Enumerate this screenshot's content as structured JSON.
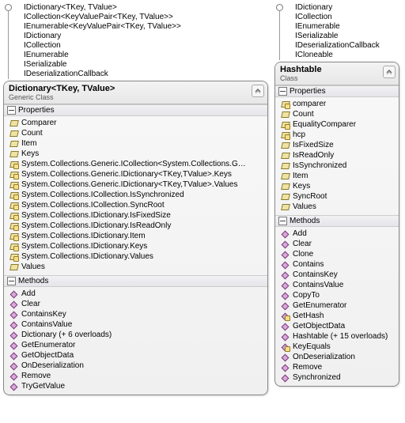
{
  "left": {
    "inherits": [
      "IDictionary<TKey, TValue>",
      "ICollection<KeyValuePair<TKey, TValue>>",
      "IEnumerable<KeyValuePair<TKey, TValue>>",
      "IDictionary",
      "ICollection",
      "IEnumerable",
      "ISerializable",
      "IDeserializationCallback"
    ],
    "title": "Dictionary<TKey, TValue>",
    "subtitle": "Generic Class",
    "sections": {
      "properties": {
        "label": "Properties",
        "items": [
          {
            "t": "Comparer",
            "p": false
          },
          {
            "t": "Count",
            "p": false
          },
          {
            "t": "Item",
            "p": false
          },
          {
            "t": "Keys",
            "p": false
          },
          {
            "t": "System.Collections.Generic.ICollection<System.Collections.G…",
            "p": true
          },
          {
            "t": "System.Collections.Generic.IDictionary<TKey,TValue>.Keys",
            "p": true
          },
          {
            "t": "System.Collections.Generic.IDictionary<TKey,TValue>.Values",
            "p": true
          },
          {
            "t": "System.Collections.ICollection.IsSynchronized",
            "p": true
          },
          {
            "t": "System.Collections.ICollection.SyncRoot",
            "p": true
          },
          {
            "t": "System.Collections.IDictionary.IsFixedSize",
            "p": true
          },
          {
            "t": "System.Collections.IDictionary.IsReadOnly",
            "p": true
          },
          {
            "t": "System.Collections.IDictionary.Item",
            "p": true
          },
          {
            "t": "System.Collections.IDictionary.Keys",
            "p": true
          },
          {
            "t": "System.Collections.IDictionary.Values",
            "p": true
          },
          {
            "t": "Values",
            "p": false
          }
        ]
      },
      "methods": {
        "label": "Methods",
        "items": [
          {
            "t": "Add",
            "p": false
          },
          {
            "t": "Clear",
            "p": false
          },
          {
            "t": "ContainsKey",
            "p": false
          },
          {
            "t": "ContainsValue",
            "p": false
          },
          {
            "t": "Dictionary (+ 6 overloads)",
            "p": false
          },
          {
            "t": "GetEnumerator",
            "p": false
          },
          {
            "t": "GetObjectData",
            "p": false
          },
          {
            "t": "OnDeserialization",
            "p": false
          },
          {
            "t": "Remove",
            "p": false
          },
          {
            "t": "TryGetValue",
            "p": false
          }
        ]
      }
    }
  },
  "right": {
    "inherits": [
      "IDictionary",
      "ICollection",
      "IEnumerable",
      "ISerializable",
      "IDeserializationCallback",
      "ICloneable"
    ],
    "title": "Hashtable",
    "subtitle": "Class",
    "sections": {
      "properties": {
        "label": "Properties",
        "items": [
          {
            "t": "comparer",
            "p": true
          },
          {
            "t": "Count",
            "p": false
          },
          {
            "t": "EqualityComparer",
            "p": true
          },
          {
            "t": "hcp",
            "p": true
          },
          {
            "t": "IsFixedSize",
            "p": false
          },
          {
            "t": "IsReadOnly",
            "p": false
          },
          {
            "t": "IsSynchronized",
            "p": false
          },
          {
            "t": "Item",
            "p": false
          },
          {
            "t": "Keys",
            "p": false
          },
          {
            "t": "SyncRoot",
            "p": false
          },
          {
            "t": "Values",
            "p": false
          }
        ]
      },
      "methods": {
        "label": "Methods",
        "items": [
          {
            "t": "Add",
            "p": false
          },
          {
            "t": "Clear",
            "p": false
          },
          {
            "t": "Clone",
            "p": false
          },
          {
            "t": "Contains",
            "p": false
          },
          {
            "t": "ContainsKey",
            "p": false
          },
          {
            "t": "ContainsValue",
            "p": false
          },
          {
            "t": "CopyTo",
            "p": false
          },
          {
            "t": "GetEnumerator",
            "p": false
          },
          {
            "t": "GetHash",
            "p": true
          },
          {
            "t": "GetObjectData",
            "p": false
          },
          {
            "t": "Hashtable (+ 15 overloads)",
            "p": false
          },
          {
            "t": "KeyEquals",
            "p": true
          },
          {
            "t": "OnDeserialization",
            "p": false
          },
          {
            "t": "Remove",
            "p": false
          },
          {
            "t": "Synchronized",
            "p": false
          }
        ]
      }
    }
  }
}
